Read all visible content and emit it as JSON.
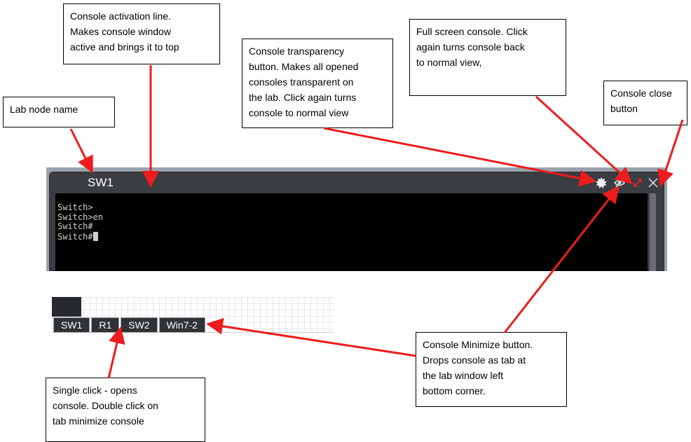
{
  "annotations": {
    "activation": [
      "Console activation line.",
      "Makes console window",
      "active and brings it to top"
    ],
    "node_name": [
      "Lab node name"
    ],
    "transparency": [
      "Console transparency",
      "button. Makes all opened",
      "consoles transparent on",
      "the lab. Click again turns",
      "console to normal view"
    ],
    "fullscreen": [
      "Full screen console. Click",
      "again turns console back",
      "to normal view,"
    ],
    "close": [
      "Console close",
      "button"
    ],
    "minimize": [
      "Console Minimize button.",
      "Drops console as tab at",
      "the lab window left",
      "bottom corner."
    ],
    "tab_click": [
      "Single click - opens",
      "console. Double click on",
      "tab minimize console"
    ]
  },
  "console": {
    "title": "SW1",
    "lines": [
      "Switch>",
      "Switch>en",
      "Switch#",
      "Switch#"
    ],
    "controls": [
      {
        "name": "transparency",
        "icon": "gear-icon"
      },
      {
        "name": "minimize",
        "icon": "eye-slash-icon"
      },
      {
        "name": "fullscreen",
        "icon": "expand-icon"
      },
      {
        "name": "close",
        "icon": "close-icon"
      }
    ]
  },
  "tabs": [
    "SW1",
    "R1",
    "SW2",
    "Win7-2"
  ],
  "colors": {
    "arrow": "#ee1c1c",
    "console_frame": "#3a3d41",
    "terminal_bg": "#000000",
    "tab_bg": "#2f3336",
    "fullscreen_icon": "#e0282e"
  }
}
